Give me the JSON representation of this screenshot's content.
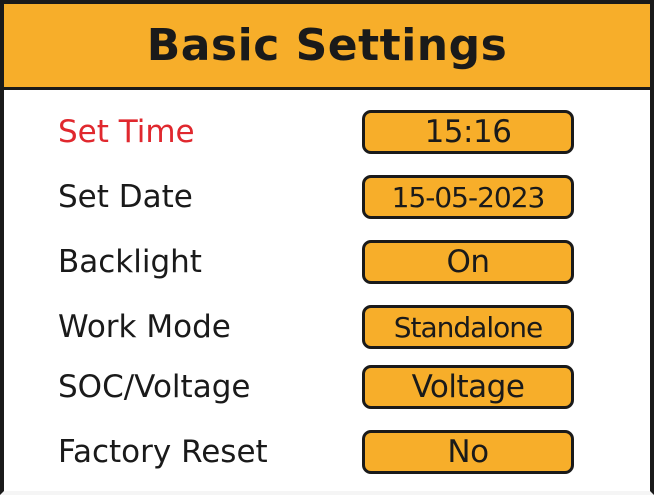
{
  "title": "Basic Settings",
  "colors": {
    "header_bg": "#f7ae2a",
    "value_bg": "#f7ae2a",
    "selected_text": "#e0282e",
    "text": "#1a1a1a",
    "border": "#1a1a1a"
  },
  "settings": [
    {
      "label": "Set Time",
      "value": "15:16",
      "selected": true
    },
    {
      "label": "Set Date",
      "value": "15-05-2023",
      "selected": false
    },
    {
      "label": "Backlight",
      "value": "On",
      "selected": false
    },
    {
      "label": "Work Mode",
      "value": "Standalone",
      "selected": false
    },
    {
      "label": "SOC/Voltage",
      "value": "Voltage",
      "selected": false
    },
    {
      "label": "Factory Reset",
      "value": "No",
      "selected": false
    }
  ]
}
